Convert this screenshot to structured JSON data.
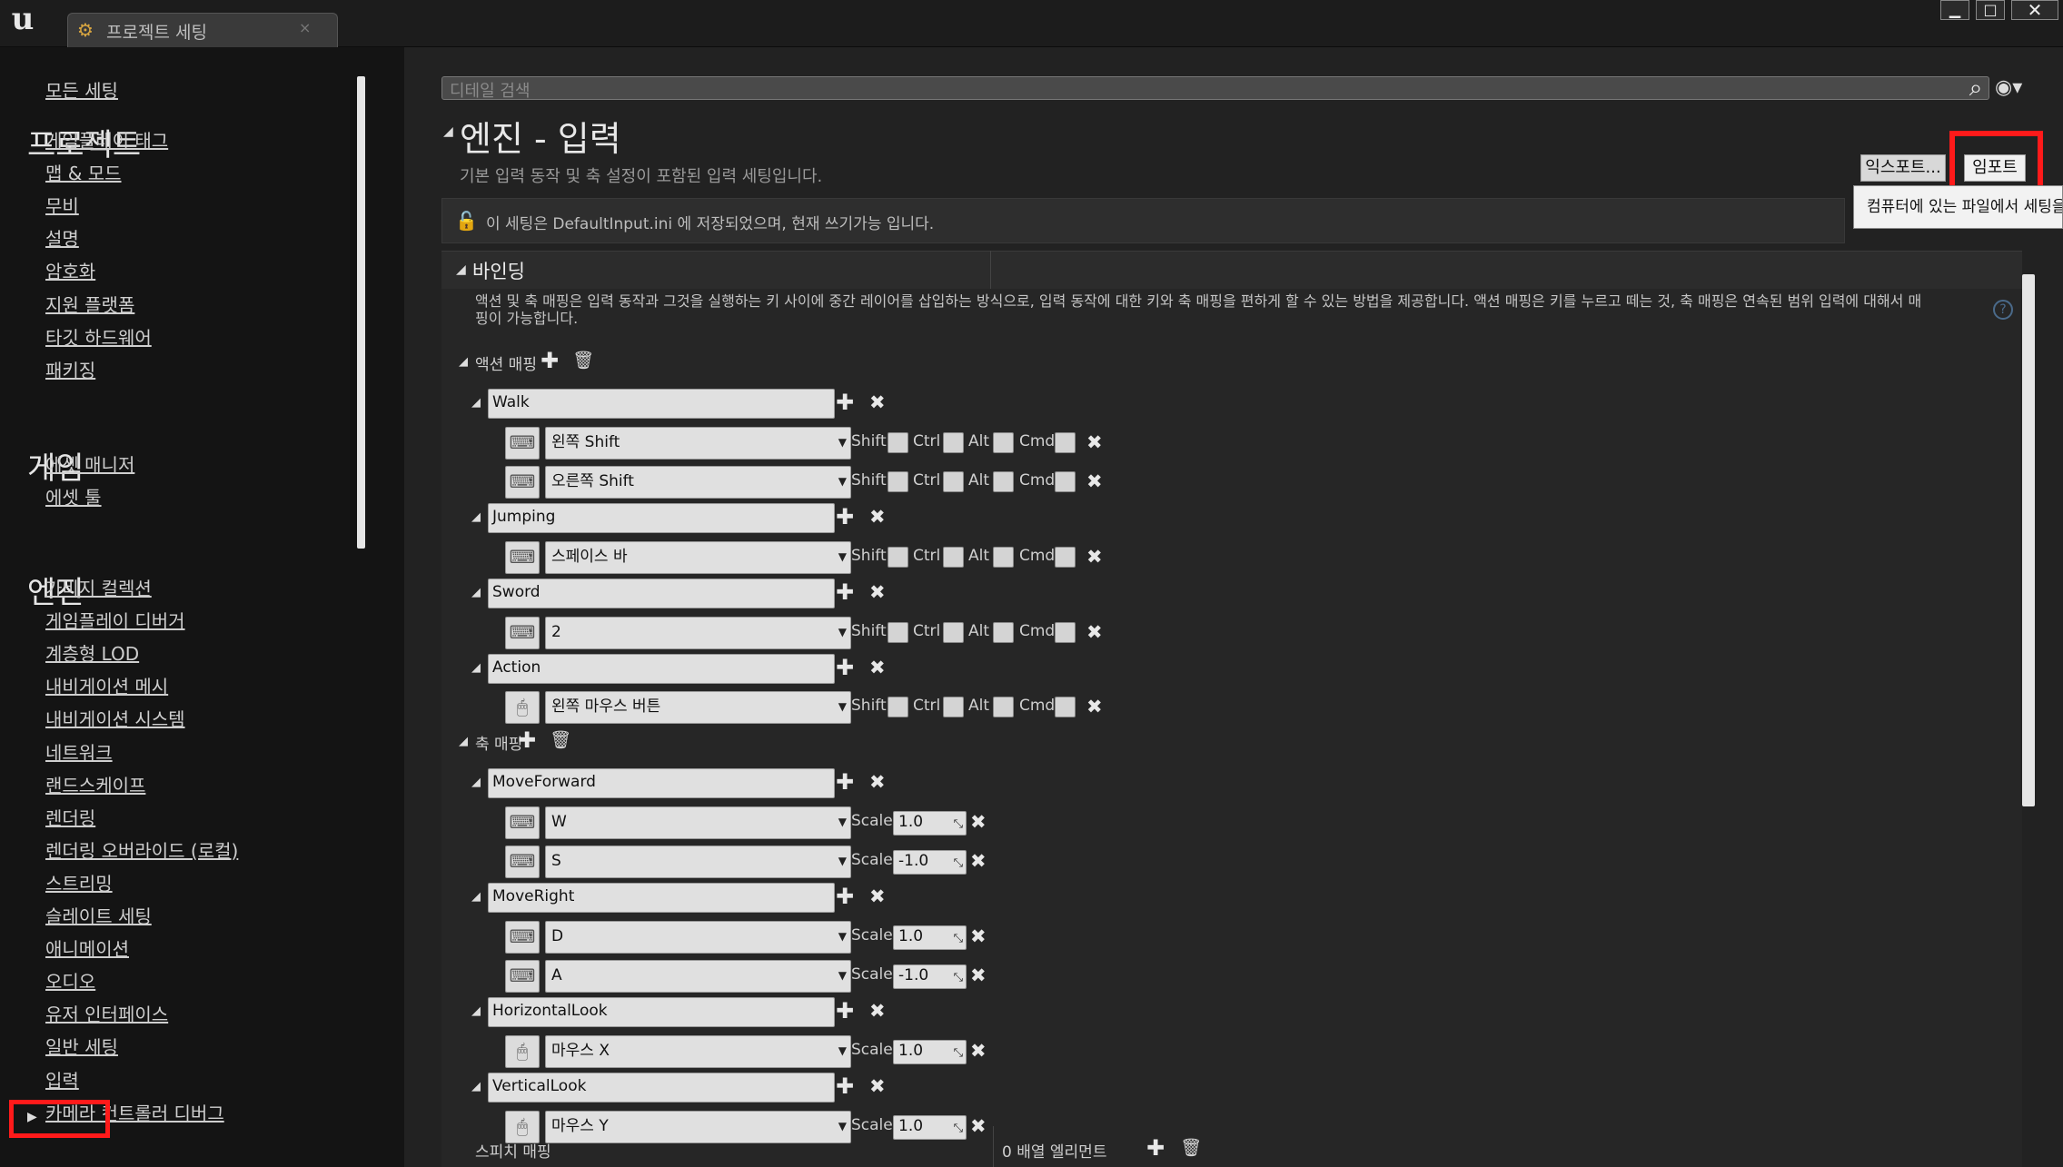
{
  "window": {
    "tab_label": "프로젝트 세팅",
    "tab_close": "×",
    "logo": "u",
    "min": "▁",
    "max": "□",
    "close": "✕"
  },
  "nav": {
    "all_settings": "모든 세팅",
    "sections": [
      {
        "title": "프로젝트",
        "items": [
          "게임플레이 태그",
          "맵 & 모드",
          "무비",
          "설명",
          "암호화",
          "지원 플랫폼",
          "타깃 하드웨어",
          "패키징"
        ]
      },
      {
        "title": "게임",
        "items": [
          "에셋 매니저",
          "에셋 툴"
        ]
      },
      {
        "title": "엔진",
        "items": [
          "가비지 컬렉션",
          "게임플레이 디버거",
          "계층형 LOD",
          "내비게이션 메시",
          "내비게이션 시스템",
          "네트워크",
          "랜드스케이프",
          "렌더링",
          "렌더링 오버라이드 (로컬)",
          "스트리밍",
          "슬레이트 세팅",
          "애니메이션",
          "오디오",
          "유저 인터페이스",
          "일반 세팅",
          "입력",
          "카메라 컨트롤러 디버그"
        ]
      }
    ],
    "selected": "입력"
  },
  "details": {
    "search_placeholder": "디테일 검색",
    "title": "엔진 - 입력",
    "description": "기본 입력 동작 및 축 설정이 포함된 입력 세팅입니다.",
    "export_label": "익스포트...",
    "import_label": "임포트",
    "tooltip": "컴퓨터에 있는 파일에서 세팅을 가",
    "notice": "이 세팅은 DefaultInput.ini 에 저장되었으며, 현재 쓰기가능 입니다."
  },
  "bindings": {
    "title": "바인딩",
    "description": "액션 및 축 매핑은 입력 동작과 그것을 실행하는 키 사이에 중간 레이어를 삽입하는 방식으로, 입력 동작에 대한 키와 축 매핑을 편하게 할 수 있는 방법을 제공합니다. 액션 매핑은 키를 누르고 떼는 것, 축 매핑은 연속된 범위 입력에 대해서 매핑이 가능합니다.",
    "action_label": "액션 매핑",
    "axis_label": "축 매핑",
    "modifiers": [
      "Shift",
      "Ctrl",
      "Alt",
      "Cmd"
    ],
    "scale_label": "Scale",
    "actions": [
      {
        "name": "Walk",
        "keys": [
          {
            "key": "왼쪽 Shift",
            "device": "keyboard"
          },
          {
            "key": "오른쪽 Shift",
            "device": "keyboard"
          }
        ]
      },
      {
        "name": "Jumping",
        "keys": [
          {
            "key": "스페이스 바",
            "device": "keyboard"
          }
        ]
      },
      {
        "name": "Sword",
        "keys": [
          {
            "key": "2",
            "device": "keyboard"
          }
        ]
      },
      {
        "name": "Action",
        "keys": [
          {
            "key": "왼쪽 마우스 버튼",
            "device": "mouse"
          }
        ]
      }
    ],
    "axes": [
      {
        "name": "MoveForward",
        "keys": [
          {
            "key": "W",
            "scale": "1.0",
            "device": "keyboard"
          },
          {
            "key": "S",
            "scale": "-1.0",
            "device": "keyboard"
          }
        ]
      },
      {
        "name": "MoveRight",
        "keys": [
          {
            "key": "D",
            "scale": "1.0",
            "device": "keyboard"
          },
          {
            "key": "A",
            "scale": "-1.0",
            "device": "keyboard"
          }
        ]
      },
      {
        "name": "HorizontalLook",
        "keys": [
          {
            "key": "마우스 X",
            "scale": "1.0",
            "device": "mouse"
          }
        ]
      },
      {
        "name": "VerticalLook",
        "keys": [
          {
            "key": "마우스 Y",
            "scale": "1.0",
            "device": "mouse"
          }
        ]
      }
    ],
    "speech_label": "스피치 매핑",
    "speech_count": "0 배열 엘리먼트"
  },
  "colors": {
    "highlight": "#ff1a1a",
    "panel": "#222222",
    "field": "#e0e0e0"
  }
}
